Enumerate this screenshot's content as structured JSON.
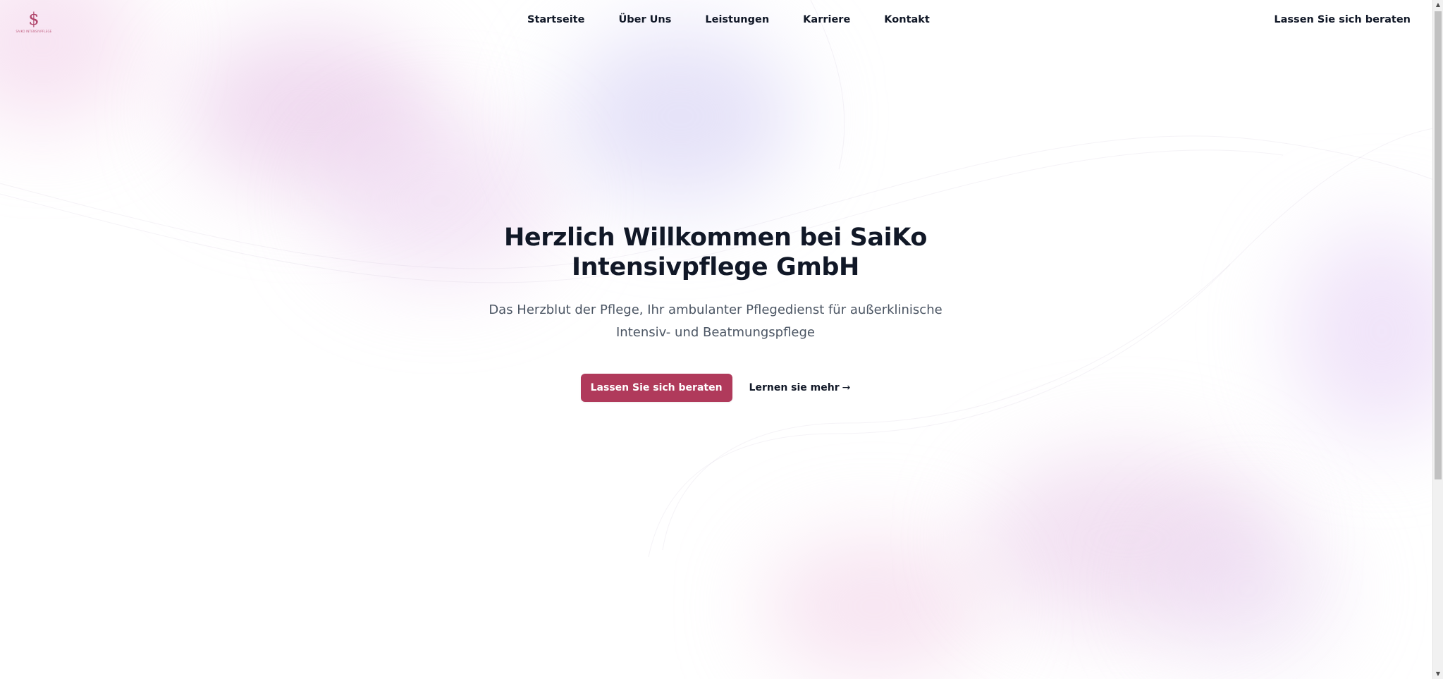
{
  "header": {
    "logo_text": "SAIKO INTENSIVPFLEGE",
    "nav": [
      {
        "label": "Startseite"
      },
      {
        "label": "Über Uns"
      },
      {
        "label": "Leistungen"
      },
      {
        "label": "Karriere"
      },
      {
        "label": "Kontakt"
      }
    ],
    "cta_label": "Lassen Sie sich beraten"
  },
  "hero": {
    "title": "Herzlich Willkommen bei SaiKo Intensivpflege GmbH",
    "subtitle": "Das Herzblut der Pflege, Ihr ambulanter Pflegedienst für außerklinische Intensiv- und Beatmungspflege",
    "primary_button": "Lassen Sie sich beraten",
    "secondary_button": "Lernen sie mehr",
    "secondary_arrow": "→"
  },
  "scrollbar": {
    "up_arrow": "▲",
    "down_arrow": "▼"
  },
  "colors": {
    "brand": "#b03a5b",
    "heading": "#111827",
    "body_text": "#4b5563"
  }
}
